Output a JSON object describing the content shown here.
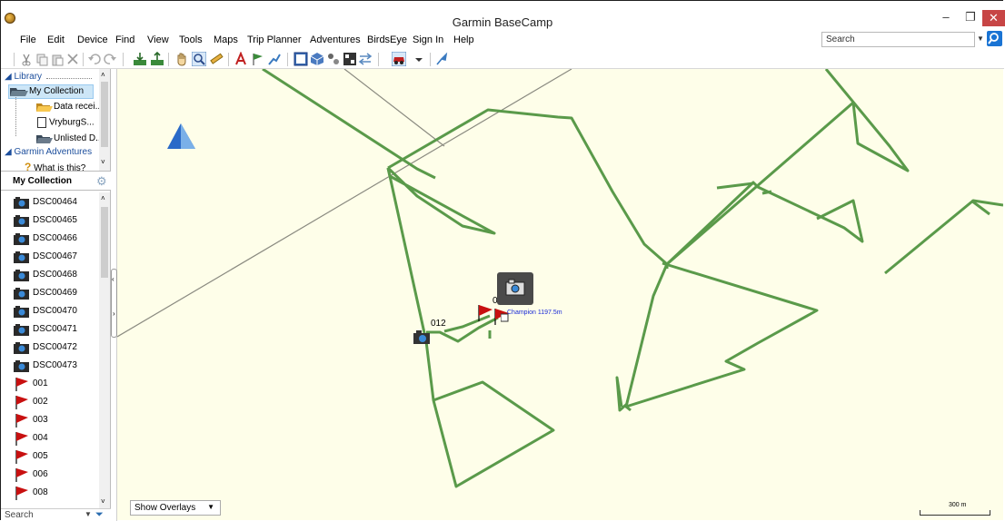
{
  "window": {
    "title": "Garmin BaseCamp",
    "minimize": "–",
    "restore": "❐",
    "close": "✕"
  },
  "menu": [
    "File",
    "Edit",
    "Device",
    "Find",
    "View",
    "Tools",
    "Maps",
    "Trip Planner",
    "Adventures",
    "BirdsEye",
    "Sign In",
    "Help"
  ],
  "search": {
    "placeholder": "Search"
  },
  "library": {
    "header": "Library",
    "items": [
      {
        "label": "My Collection",
        "icon": "open-folder-icon"
      },
      {
        "label": "Data recei...",
        "icon": "folder-icon"
      },
      {
        "label": "VryburgS...",
        "icon": "document-icon"
      },
      {
        "label": "Unlisted D...",
        "icon": "folder-icon"
      }
    ],
    "adventures_header": "Garmin Adventures",
    "what_is_this": "What is this?"
  },
  "collection": {
    "header": "My Collection",
    "photos": [
      "DSC00464",
      "DSC00465",
      "DSC00466",
      "DSC00467",
      "DSC00468",
      "DSC00469",
      "DSC00470",
      "DSC00471",
      "DSC00472",
      "DSC00473"
    ],
    "waypoints": [
      "001",
      "002",
      "003",
      "004",
      "005",
      "006",
      "008"
    ]
  },
  "bottom_search": {
    "label": "Search"
  },
  "map": {
    "overlay_select": "Show Overlays",
    "scale_label": "300 m",
    "waypoint_012": "012",
    "waypoint_0": "0",
    "champion_label": "Champion 1197.5m",
    "track_color": "#5a9a4a",
    "background_color": "#fefee9"
  }
}
